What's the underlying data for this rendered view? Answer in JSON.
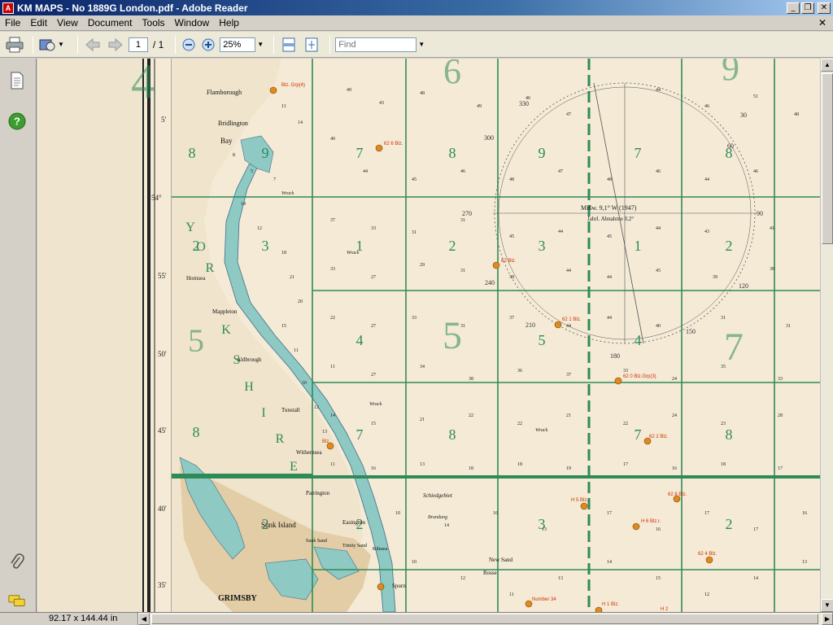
{
  "window": {
    "title": "KM MAPS - No 1889G London.pdf - Adobe Reader",
    "controls": [
      "_",
      "❐",
      "✕"
    ]
  },
  "menu": {
    "items": [
      "File",
      "Edit",
      "View",
      "Document",
      "Tools",
      "Window",
      "Help"
    ],
    "close": "✕"
  },
  "toolbar": {
    "page_current": "1",
    "page_total": "/ 1",
    "zoom": "25%",
    "find_placeholder": "Find"
  },
  "status": {
    "page_size": "92.17 x 144.44 in"
  },
  "map": {
    "place_labels": [
      "Flamborough",
      "Bridlington",
      "Bay",
      "Hornsea",
      "Mappleton",
      "Aldbrough",
      "Tunstall",
      "Withernsea",
      "Patrington",
      "Sunk Island",
      "Easington",
      "Sunk Sand",
      "Trinity Sand",
      "Kilnsea",
      "Spurn",
      "GRIMSBY",
      "Schiedgebiet",
      "New Sand",
      "Rosse"
    ],
    "region_letters": [
      "Y",
      "O",
      "R",
      "K",
      "S",
      "H",
      "I",
      "R",
      "E"
    ],
    "grid_numbers": [
      "7",
      "8",
      "9",
      "7",
      "8",
      "3",
      "1",
      "2",
      "3",
      "1",
      "2",
      "4",
      "4",
      "5",
      "7",
      "8",
      "9",
      "7",
      "8",
      "2",
      "2",
      "3"
    ],
    "large_grid_numbers": [
      "6",
      "9",
      "5",
      "5",
      "4",
      "7"
    ],
    "lat_labels": [
      "54°",
      "55'",
      "50'",
      "45'",
      "40'",
      "35'",
      "5'"
    ],
    "compass": {
      "labels": [
        "Mißw. 9,1° W (1947)",
        "Jahrl. Abnahme 0,2°"
      ],
      "degrees": [
        "270",
        "90",
        "180",
        "300",
        "60",
        "240",
        "120",
        "150",
        "210",
        "30",
        "330"
      ]
    },
    "light_labels": [
      "62 6 Blz.",
      "62 Blz.",
      "62 1 Blz.",
      "62 0 Blz.Grp(3)",
      "62 2 Blz.",
      "62 8 Blz.",
      "H 5 Blz.",
      "H 6 Blz.r.",
      "62 4 Blz.",
      "Number 34",
      "H 1 Blz.",
      "H 2",
      "Blz. Grp(4)",
      "Blz."
    ],
    "misc_labels": [
      "Wrack",
      "Wrack",
      "Wrack",
      "Wrack",
      "Brundung"
    ],
    "colors": {
      "paper": "#f4ead6",
      "grid": "#2e8b57",
      "water": "#8ec9c3",
      "land": "#e2cda6",
      "ink": "#222222",
      "light": "#cc3300"
    }
  }
}
